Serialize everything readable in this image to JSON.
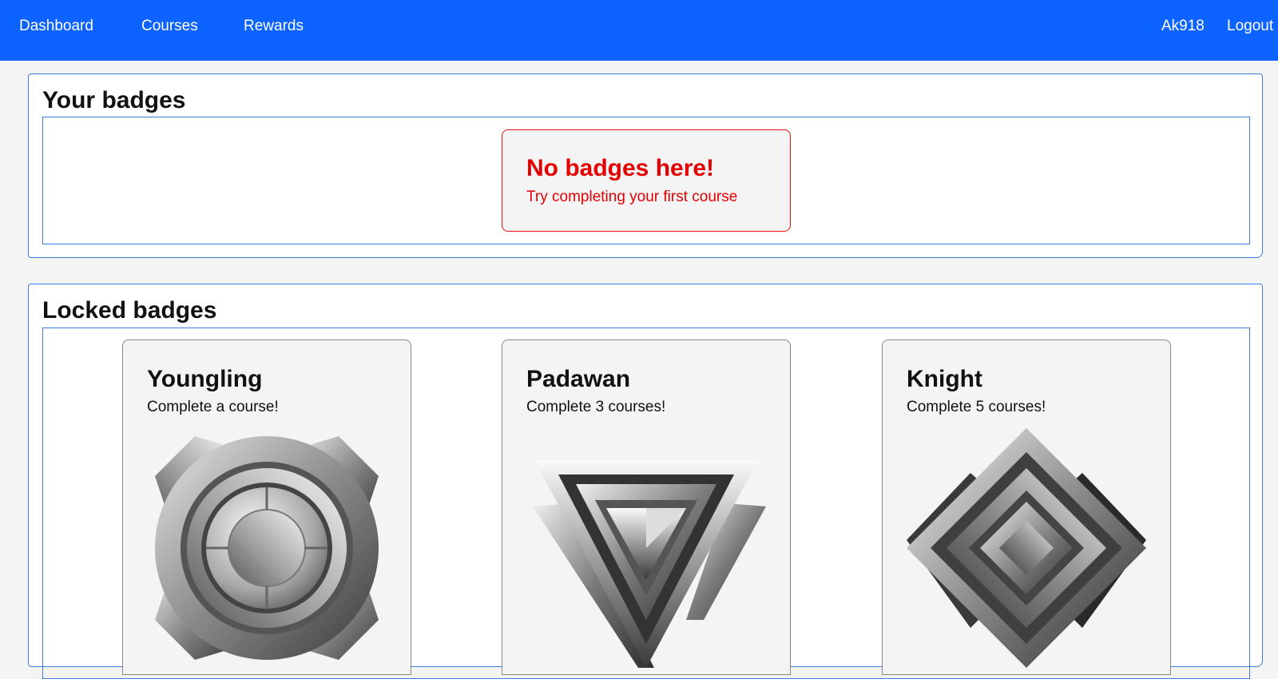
{
  "nav": {
    "links": [
      "Dashboard",
      "Courses",
      "Rewards"
    ],
    "user": "Ak918",
    "logout": "Logout",
    "color": "#0d63ff"
  },
  "your_badges": {
    "title": "Your badges",
    "empty_title": "No badges here!",
    "empty_subtitle": "Try completing your first course"
  },
  "locked_badges": {
    "title": "Locked badges",
    "badges": [
      {
        "name": "Youngling",
        "requirement": "Complete a course!",
        "icon": "gear-ring-badge-icon"
      },
      {
        "name": "Padawan",
        "requirement": "Complete 3 courses!",
        "icon": "triangle-badge-icon"
      },
      {
        "name": "Knight",
        "requirement": "Complete 5 courses!",
        "icon": "diamond-badge-icon"
      }
    ]
  }
}
